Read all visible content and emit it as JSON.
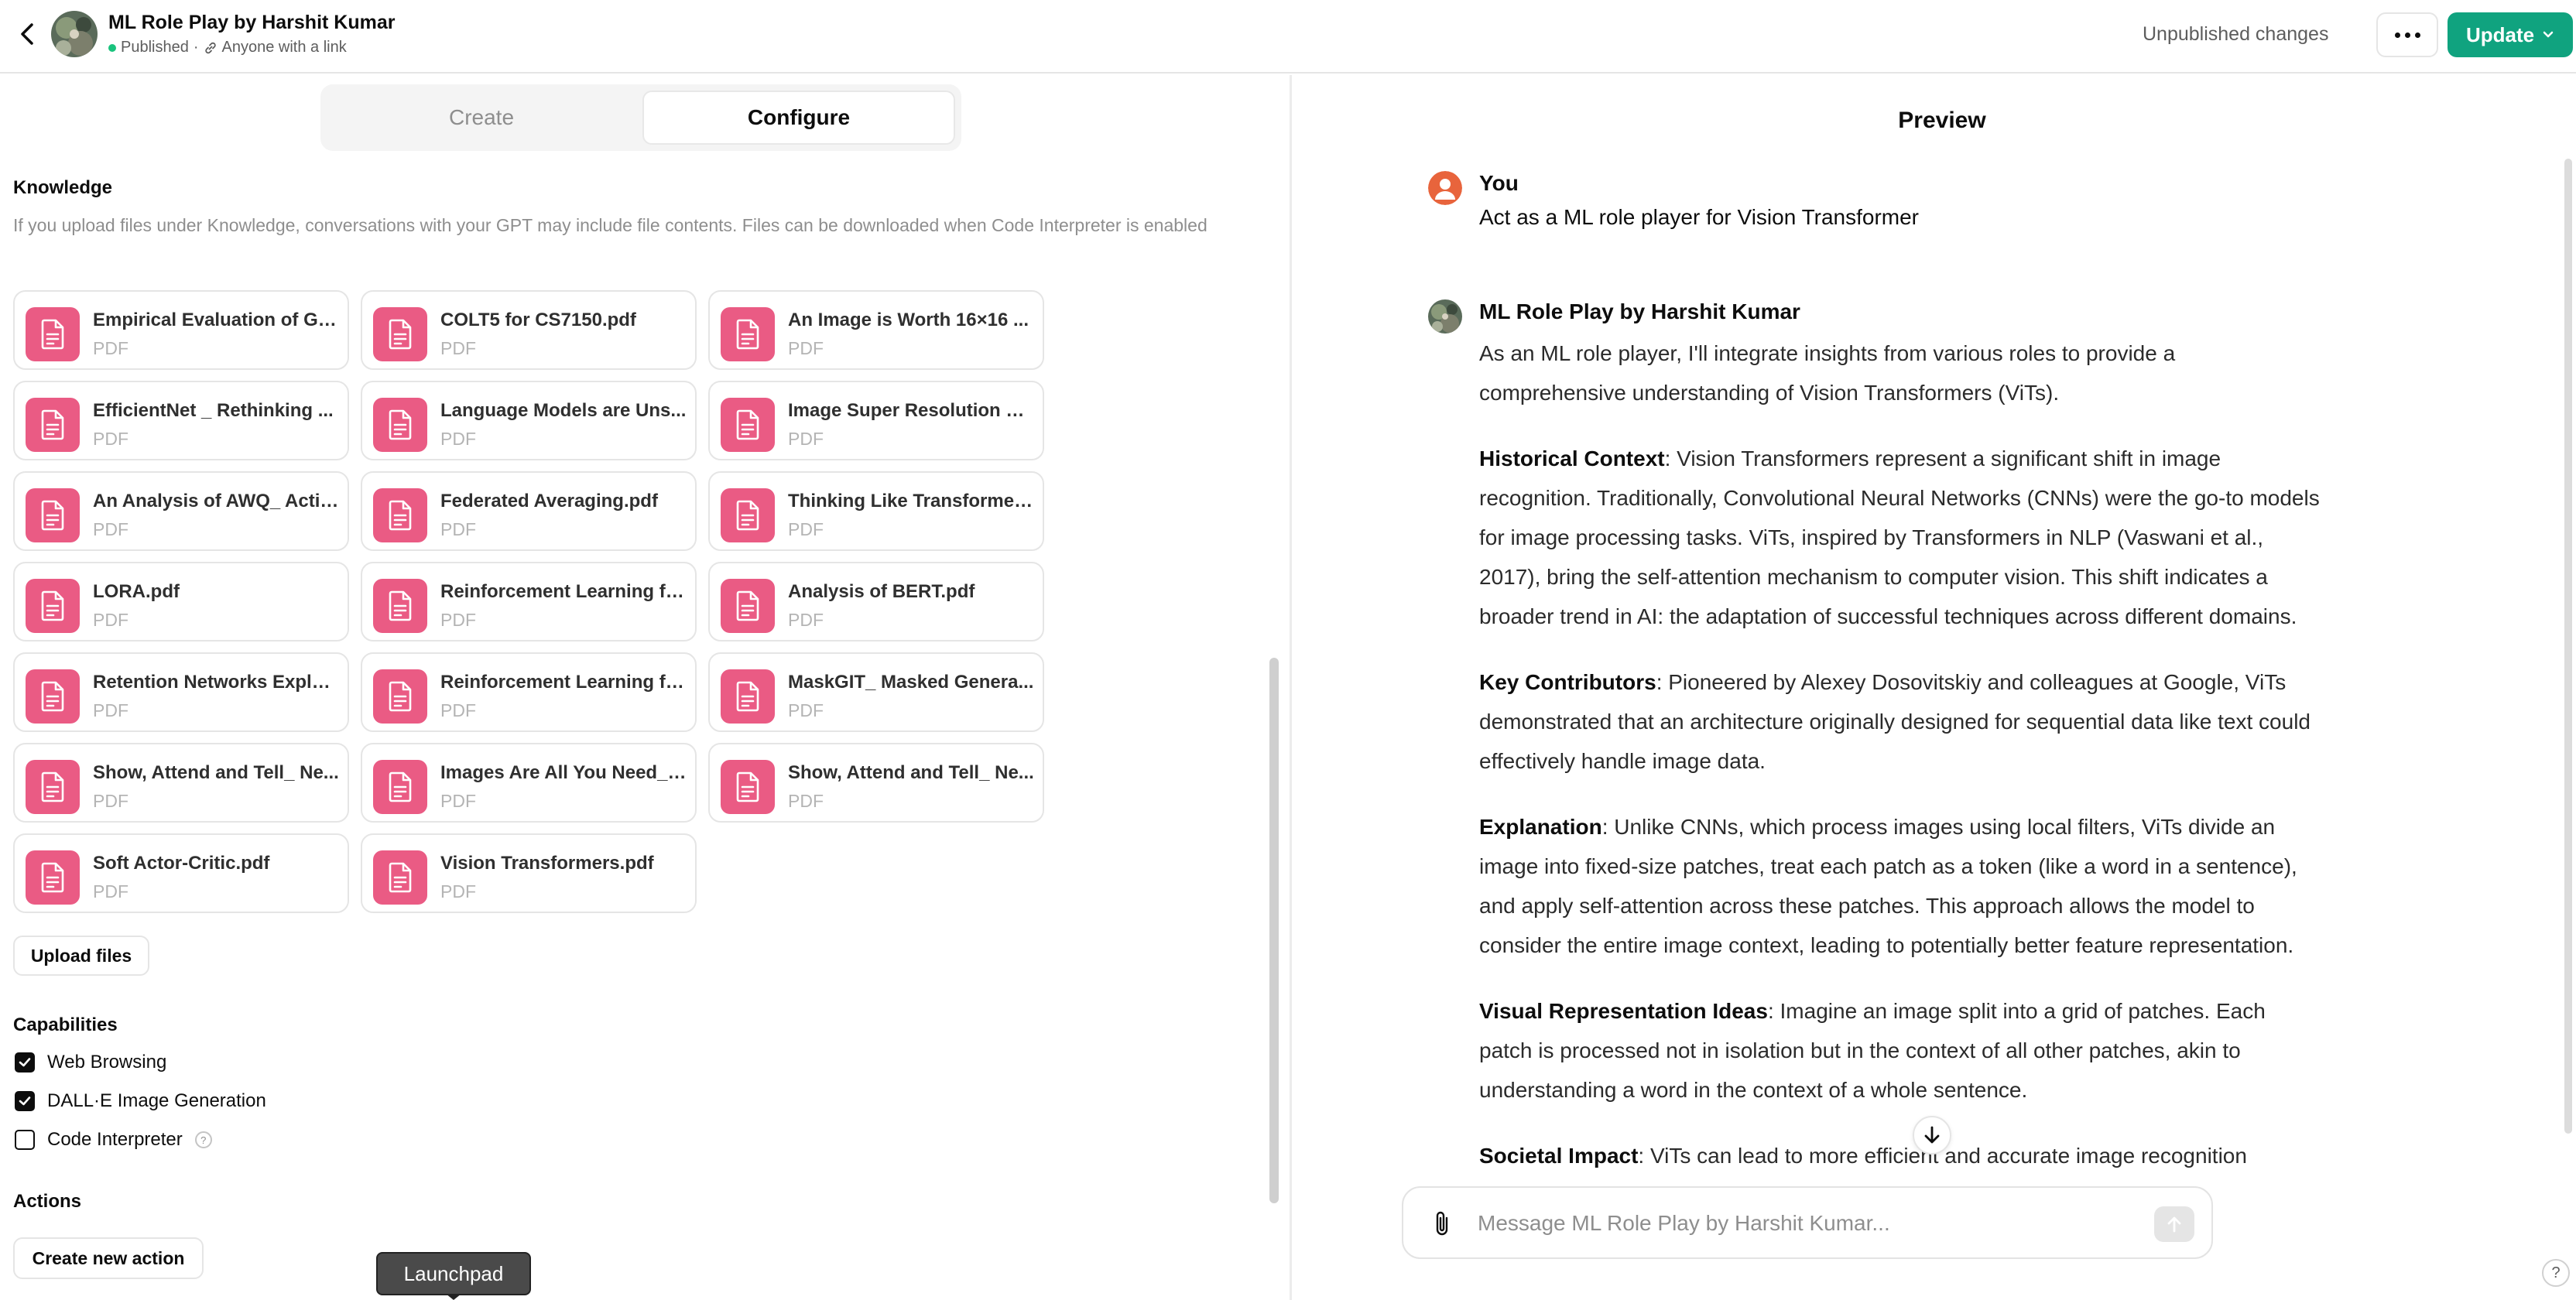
{
  "header": {
    "gpt_name": "ML Role Play by Harshit Kumar",
    "status": "Published",
    "separator": "·",
    "visibility": "Anyone with a link",
    "unpublished_changes": "Unpublished changes",
    "update_label": "Update"
  },
  "tabs": [
    {
      "label": "Create",
      "active": false
    },
    {
      "label": "Configure",
      "active": true
    }
  ],
  "knowledge": {
    "title": "Knowledge",
    "description": "If you upload files under Knowledge, conversations with your GPT may include file contents. Files can be downloaded when Code Interpreter is enabled",
    "files": [
      {
        "name": "Empirical Evaluation of Ga...",
        "type": "PDF"
      },
      {
        "name": "COLT5 for CS7150.pdf",
        "type": "PDF"
      },
      {
        "name": "An Image is Worth 16×16 ...",
        "type": "PDF"
      },
      {
        "name": "EfficientNet _ Rethinking ...",
        "type": "PDF"
      },
      {
        "name": "Language Models are Uns...",
        "type": "PDF"
      },
      {
        "name": "Image Super Resolution us...",
        "type": "PDF"
      },
      {
        "name": "An Analysis of AWQ_ Activ...",
        "type": "PDF"
      },
      {
        "name": "Federated Averaging.pdf",
        "type": "PDF"
      },
      {
        "name": "Thinking Like Transformer...",
        "type": "PDF"
      },
      {
        "name": "LORA.pdf",
        "type": "PDF"
      },
      {
        "name": "Reinforcement Learning fo...",
        "type": "PDF"
      },
      {
        "name": "Analysis of BERT.pdf",
        "type": "PDF"
      },
      {
        "name": "Retention Networks Explai...",
        "type": "PDF"
      },
      {
        "name": "Reinforcement Learning fo...",
        "type": "PDF"
      },
      {
        "name": "MaskGIT_ Masked Genera...",
        "type": "PDF"
      },
      {
        "name": "Show, Attend and Tell_ Ne...",
        "type": "PDF"
      },
      {
        "name": "Images Are All You Need_ ...",
        "type": "PDF"
      },
      {
        "name": "Show, Attend and Tell_ Ne...",
        "type": "PDF"
      },
      {
        "name": "Soft Actor-Critic.pdf",
        "type": "PDF"
      },
      {
        "name": "Vision Transformers.pdf",
        "type": "PDF"
      }
    ],
    "upload_label": "Upload files"
  },
  "capabilities": {
    "title": "Capabilities",
    "items": [
      {
        "label": "Web Browsing",
        "checked": true
      },
      {
        "label": "DALL·E Image Generation",
        "checked": true
      },
      {
        "label": "Code Interpreter",
        "checked": false,
        "help": "?"
      }
    ]
  },
  "actions": {
    "title": "Actions",
    "create_label": "Create new action"
  },
  "tooltip": "Launchpad",
  "preview": {
    "title": "Preview",
    "user_name": "You",
    "user_message": "Act as a ML role player for Vision Transformer",
    "assistant_name": "ML Role Play by Harshit Kumar",
    "intro": "As an ML role player, I'll integrate insights from various roles to provide a comprehensive understanding of Vision Transformers (ViTs).",
    "sections": [
      {
        "heading": "Historical Context",
        "text": ": Vision Transformers represent a significant shift in image recognition. Traditionally, Convolutional Neural Networks (CNNs) were the go-to models for image processing tasks. ViTs, inspired by Transformers in NLP (Vaswani et al., 2017), bring the self-attention mechanism to computer vision. This shift indicates a broader trend in AI: the adaptation of successful techniques across different domains."
      },
      {
        "heading": "Key Contributors",
        "text": ": Pioneered by Alexey Dosovitskiy and colleagues at Google, ViTs demonstrated that an architecture originally designed for sequential data like text could effectively handle image data."
      },
      {
        "heading": "Explanation",
        "text": ": Unlike CNNs, which process images using local filters, ViTs divide an image into fixed-size patches, treat each patch as a token (like a word in a sentence), and apply self-attention across these patches. This approach allows the model to consider the entire image context, leading to potentially better feature representation."
      },
      {
        "heading": "Visual Representation Ideas",
        "text": ": Imagine an image split into a grid of patches. Each patch is processed not in isolation but in the context of all other patches, akin to understanding a word in the context of a whole sentence."
      },
      {
        "heading": "Societal Impact",
        "text": ": ViTs can lead to more efficient and accurate image recognition"
      }
    ],
    "composer_placeholder": "Message ML Role Play by Harshit Kumar...",
    "help": "?"
  },
  "colors": {
    "accent_green": "#10a37f",
    "pdf_icon_pink": "#ea5b84",
    "user_avatar_orange": "#e8643c",
    "published_dot": "#19c37d"
  }
}
